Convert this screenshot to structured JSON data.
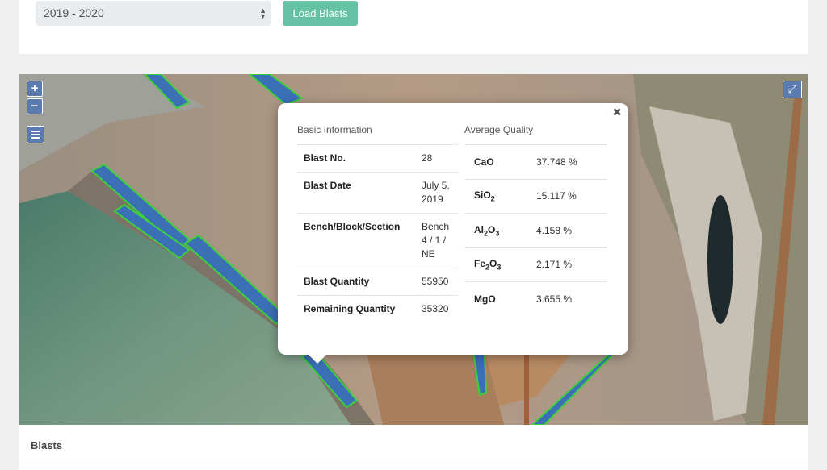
{
  "filter": {
    "season_value": "2019 - 2020",
    "load_label": "Load Blasts"
  },
  "map": {
    "zoom_in": "+",
    "zoom_out": "−",
    "controls": [
      "zoom-in",
      "zoom-out",
      "layers-menu",
      "fullscreen-toggle"
    ]
  },
  "popup": {
    "close": "✖",
    "basic_title": "Basic Information",
    "quality_title": "Average Quality",
    "basic_info": [
      {
        "label": "Blast No.",
        "value": "28"
      },
      {
        "label": "Blast Date",
        "value": "July 5, 2019"
      },
      {
        "label": "Bench/Block/Section",
        "value": "Bench 4 / 1 / NE"
      },
      {
        "label": "Blast Quantity",
        "value": "55950"
      },
      {
        "label": "Remaining Quantity",
        "value": "35320"
      }
    ],
    "quality": [
      {
        "label": "CaO",
        "value": "37.748 %"
      },
      {
        "label": "SiO2",
        "value": "15.117 %"
      },
      {
        "label": "Al2O3",
        "value": "4.158 %"
      },
      {
        "label": "Fe2O3",
        "value": "2.171 %"
      },
      {
        "label": "MgO",
        "value": "3.655 %"
      }
    ]
  },
  "blasts_section": {
    "title": "Blasts"
  },
  "colors": {
    "accent_button": "#66c2a5",
    "map_control": "#5a7ab0",
    "blast_fill": "#3b6fb6",
    "blast_outline": "#3dd13d"
  }
}
